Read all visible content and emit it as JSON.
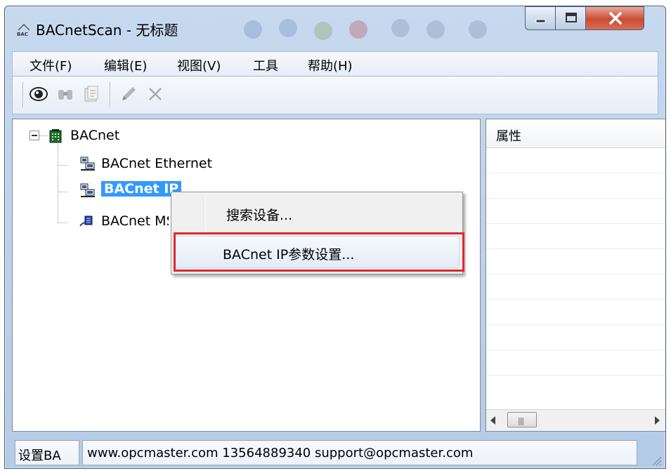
{
  "window": {
    "title": "BACnetScan - 无标题"
  },
  "menubar": {
    "items": [
      {
        "label": "文件(F)"
      },
      {
        "label": "编辑(E)"
      },
      {
        "label": "视图(V)"
      },
      {
        "label": "工具"
      },
      {
        "label": "帮助(H)"
      }
    ]
  },
  "toolbar": {
    "buttons": [
      {
        "icon": "eye-icon",
        "enabled": true
      },
      {
        "icon": "binoculars-icon",
        "enabled": false
      },
      {
        "icon": "properties-icon",
        "enabled": false
      },
      {
        "icon": "pencil-icon",
        "enabled": false
      },
      {
        "icon": "delete-x-icon",
        "enabled": false
      }
    ]
  },
  "tree": {
    "root": {
      "label": "BACnet",
      "icon": "building-icon",
      "expanded": true
    },
    "children": [
      {
        "label": "BACnet Ethernet",
        "icon": "network-computer-icon",
        "selected": false
      },
      {
        "label": "BACnet IP",
        "icon": "network-computer-icon",
        "selected": true
      },
      {
        "label": "BACnet MS/TP",
        "icon": "serial-port-icon",
        "selected": false
      }
    ]
  },
  "context_menu": {
    "items": [
      {
        "label": "搜索设备..."
      },
      {
        "label": "BACnet IP参数设置..."
      }
    ],
    "highlighted_index": 1,
    "highlight_color": "#e0282e"
  },
  "properties": {
    "header": "属性"
  },
  "statusbar": {
    "left": "设置BA",
    "main": "www.opcmaster.com 13564889340 support@opcmaster.com"
  },
  "colors": {
    "selection": "#3399ff",
    "title_gradient_top": "#c7d9ef",
    "close_button": "#c94d33"
  }
}
